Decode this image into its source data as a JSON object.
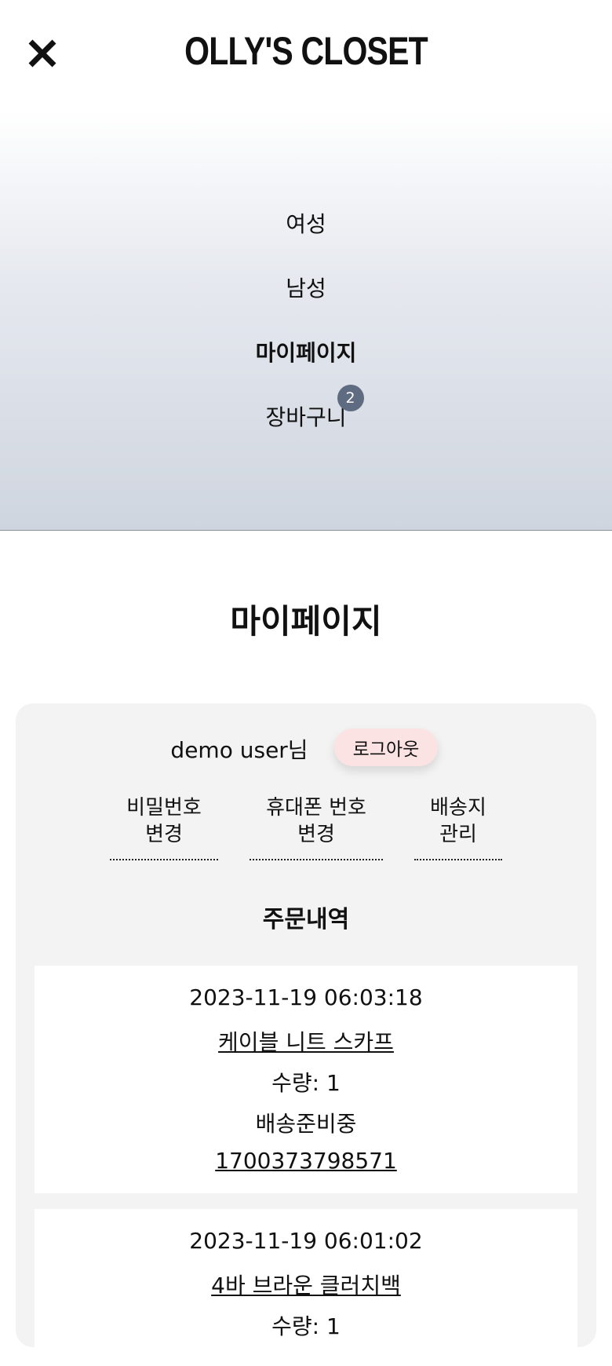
{
  "header": {
    "brand": "OLLY'S CLOSET",
    "close_icon": "close-icon"
  },
  "menu": {
    "items": [
      {
        "label": "여성"
      },
      {
        "label": "남성"
      },
      {
        "label": "마이페이지"
      },
      {
        "label": "장바구니"
      }
    ],
    "cart_count": "2"
  },
  "page": {
    "title": "마이페이지"
  },
  "user": {
    "name": "demo user님",
    "logout_label": "로그아웃"
  },
  "account_links": [
    {
      "line1": "비밀번호",
      "line2": "변경"
    },
    {
      "line1": "휴대폰 번호",
      "line2": "변경"
    },
    {
      "line1": "배송지",
      "line2": "관리"
    }
  ],
  "orders": {
    "title": "주문내역",
    "items": [
      {
        "date": "2023-11-19 06:03:18",
        "product": "케이블 니트 스카프",
        "quantity": "수량: 1",
        "status": "배송준비중",
        "order_no": "1700373798571"
      },
      {
        "date": "2023-11-19 06:01:02",
        "product": "4바 브라운 클러치백",
        "quantity": "수량: 1"
      }
    ]
  },
  "colors": {
    "badge": "#5f6b80",
    "logout_bg": "#fbe3e3",
    "card_bg": "#f3f3f3"
  }
}
